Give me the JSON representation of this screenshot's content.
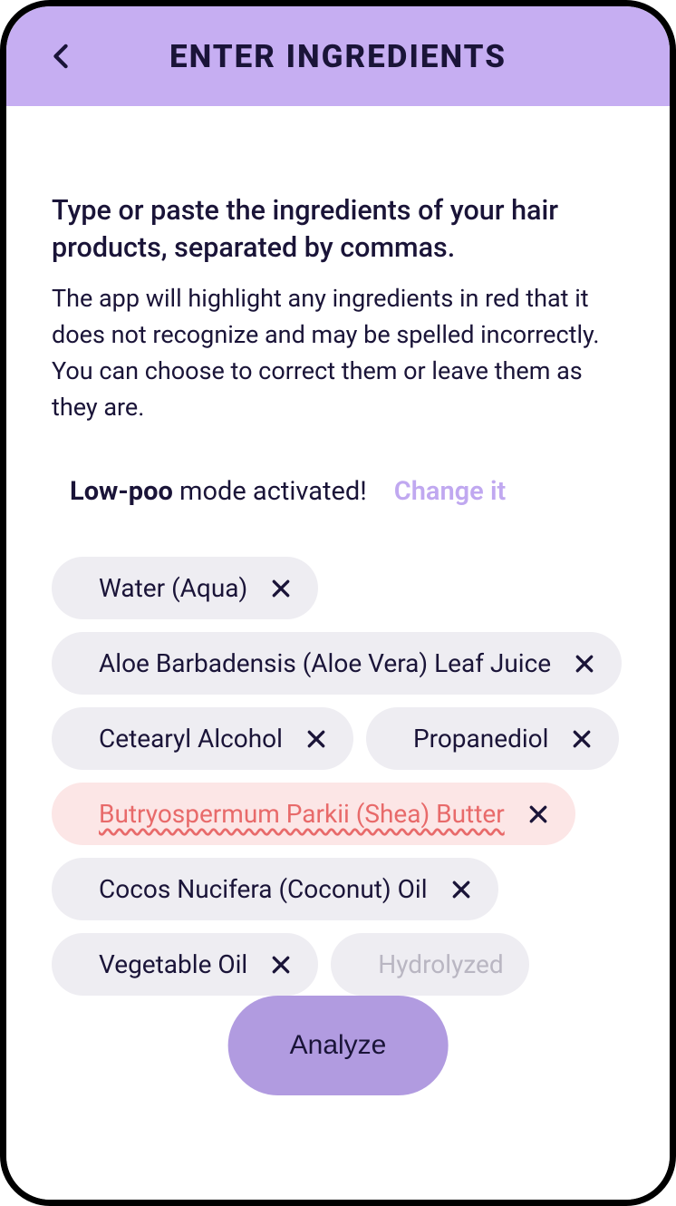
{
  "header": {
    "title": "ENTER INGREDIENTS"
  },
  "instructions": {
    "primary": "Type or paste the ingredients of your hair products, separated by commas.",
    "secondary": "The app will highlight any ingredients in red that it does not recognize and may be spelled incorrectly. You can choose to correct them or leave them as they are."
  },
  "mode": {
    "name": "Low-poo",
    "suffix": " mode activated!",
    "change_label": "Change it"
  },
  "ingredients": [
    {
      "label": "Water (Aqua)",
      "error": false,
      "faded": false,
      "showClose": true
    },
    {
      "label": "Aloe Barbadensis (Aloe Vera) Leaf Juice",
      "error": false,
      "faded": false,
      "showClose": true
    },
    {
      "label": "Cetearyl Alcohol",
      "error": false,
      "faded": false,
      "showClose": true
    },
    {
      "label": "Propanediol",
      "error": false,
      "faded": false,
      "showClose": true
    },
    {
      "label": "Butryospermum Parkii (Shea) Butter",
      "error": true,
      "faded": false,
      "showClose": true
    },
    {
      "label": "Cocos Nucifera (Coconut) Oil",
      "error": false,
      "faded": false,
      "showClose": true
    },
    {
      "label": "Vegetable Oil",
      "error": false,
      "faded": false,
      "showClose": true
    },
    {
      "label": "Hydrolyzed",
      "error": false,
      "faded": true,
      "showClose": false
    }
  ],
  "analyze_label": "Analyze"
}
